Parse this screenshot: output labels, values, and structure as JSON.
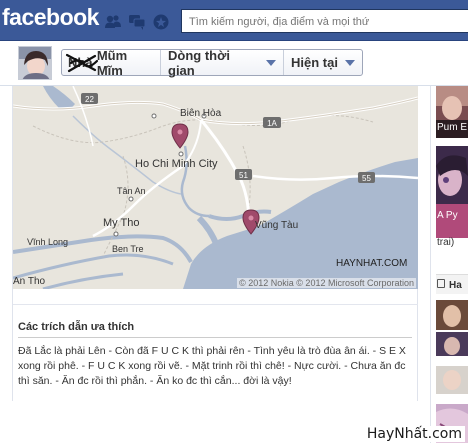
{
  "header": {
    "logo": "facebook",
    "search": {
      "placeholder": "Tìm kiếm người, địa điểm và mọi thứ"
    },
    "icons": [
      "friend-requests-icon",
      "messages-icon",
      "notifications-icon"
    ]
  },
  "profile": {
    "name": "Mũm Mĩm",
    "scribble": "Nhà",
    "timeline_label": "Dòng thời gian",
    "current_label": "Hiện tại"
  },
  "map": {
    "labels": [
      "Biên Hòa",
      "Ho Chi Minh City",
      "My Tho",
      "Vũng Tàu",
      "Tân An",
      "Vĩnh Long",
      "Ben Tre",
      "An Tho"
    ],
    "highway_signs": [
      "22",
      "1A",
      "51",
      "55"
    ],
    "copyright": "© 2012 Nokia  © 2012 Microsoft Corporation",
    "site_tag": "HAYNHAT.COM"
  },
  "quotes": {
    "title": "Các trích dẫn ưa thích",
    "body": "Đã Lắc là phải Lên - Còn đã F U C K thì phải rên - Tình yêu là trò đùa ân ái. - S E X xong rồi phê. - F U C K xong rồi vẽ. - Mặt trinh rồi thì chê! - Nực cười. - Chưa ăn đc thì săn. - Ăn đc rồi thì phắn. - Ăn ko đc thì cắn... đời là vậy!"
  },
  "sidebar": {
    "items": [
      {
        "caption": "Pum E"
      },
      {
        "caption": "A Py",
        "caption2": "trai)"
      },
      {
        "caption": "Ha"
      }
    ]
  },
  "watermark": "HayNhất.com",
  "colors": {
    "brand": "#3b5998",
    "pin": "#a04a6b",
    "water": "#aab9cf"
  }
}
